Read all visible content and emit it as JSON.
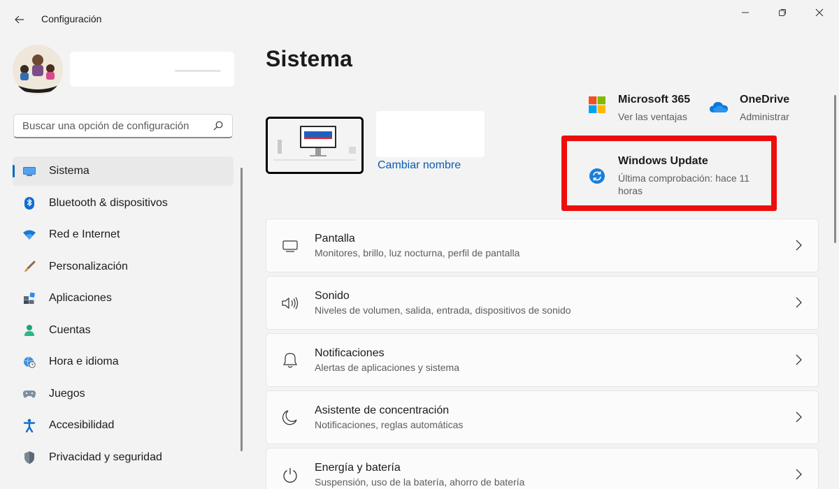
{
  "titlebar": {
    "app_title": "Configuración",
    "back_icon": "arrow-left-icon",
    "minimize_icon": "minimize-icon",
    "maximize_icon": "restore-icon",
    "close_icon": "close-icon"
  },
  "search": {
    "placeholder": "Buscar una opción de configuración"
  },
  "sidebar": {
    "items": [
      {
        "label": "Sistema",
        "icon": "monitor-icon",
        "active": true
      },
      {
        "label": "Bluetooth & dispositivos",
        "icon": "bluetooth-icon"
      },
      {
        "label": "Red e Internet",
        "icon": "wifi-icon"
      },
      {
        "label": "Personalización",
        "icon": "brush-icon"
      },
      {
        "label": "Aplicaciones",
        "icon": "apps-icon"
      },
      {
        "label": "Cuentas",
        "icon": "person-icon"
      },
      {
        "label": "Hora e idioma",
        "icon": "globe-clock-icon"
      },
      {
        "label": "Juegos",
        "icon": "gamepad-icon"
      },
      {
        "label": "Accesibilidad",
        "icon": "accessibility-icon"
      },
      {
        "label": "Privacidad y seguridad",
        "icon": "shield-icon"
      }
    ]
  },
  "main": {
    "title": "Sistema",
    "device": {
      "rename_label": "Cambiar nombre"
    },
    "quick": {
      "m365": {
        "title": "Microsoft 365",
        "subtitle": "Ver las ventajas"
      },
      "onedrive": {
        "title": "OneDrive",
        "subtitle": "Administrar"
      },
      "update": {
        "title": "Windows Update",
        "subtitle": "Última comprobación: hace 11 horas"
      }
    },
    "cards": [
      {
        "title": "Pantalla",
        "subtitle": "Monitores, brillo, luz nocturna, perfil de pantalla",
        "icon": "display-icon"
      },
      {
        "title": "Sonido",
        "subtitle": "Niveles de volumen, salida, entrada, dispositivos de sonido",
        "icon": "speaker-icon"
      },
      {
        "title": "Notificaciones",
        "subtitle": "Alertas de aplicaciones y sistema",
        "icon": "bell-icon"
      },
      {
        "title": "Asistente de concentración",
        "subtitle": "Notificaciones, reglas automáticas",
        "icon": "moon-icon"
      },
      {
        "title": "Energía y batería",
        "subtitle": "Suspensión, uso de la batería, ahorro de batería",
        "icon": "power-icon"
      }
    ]
  },
  "colors": {
    "accent": "#0067c0",
    "highlight": "#ee0d0d",
    "background": "#f3f3f3"
  }
}
